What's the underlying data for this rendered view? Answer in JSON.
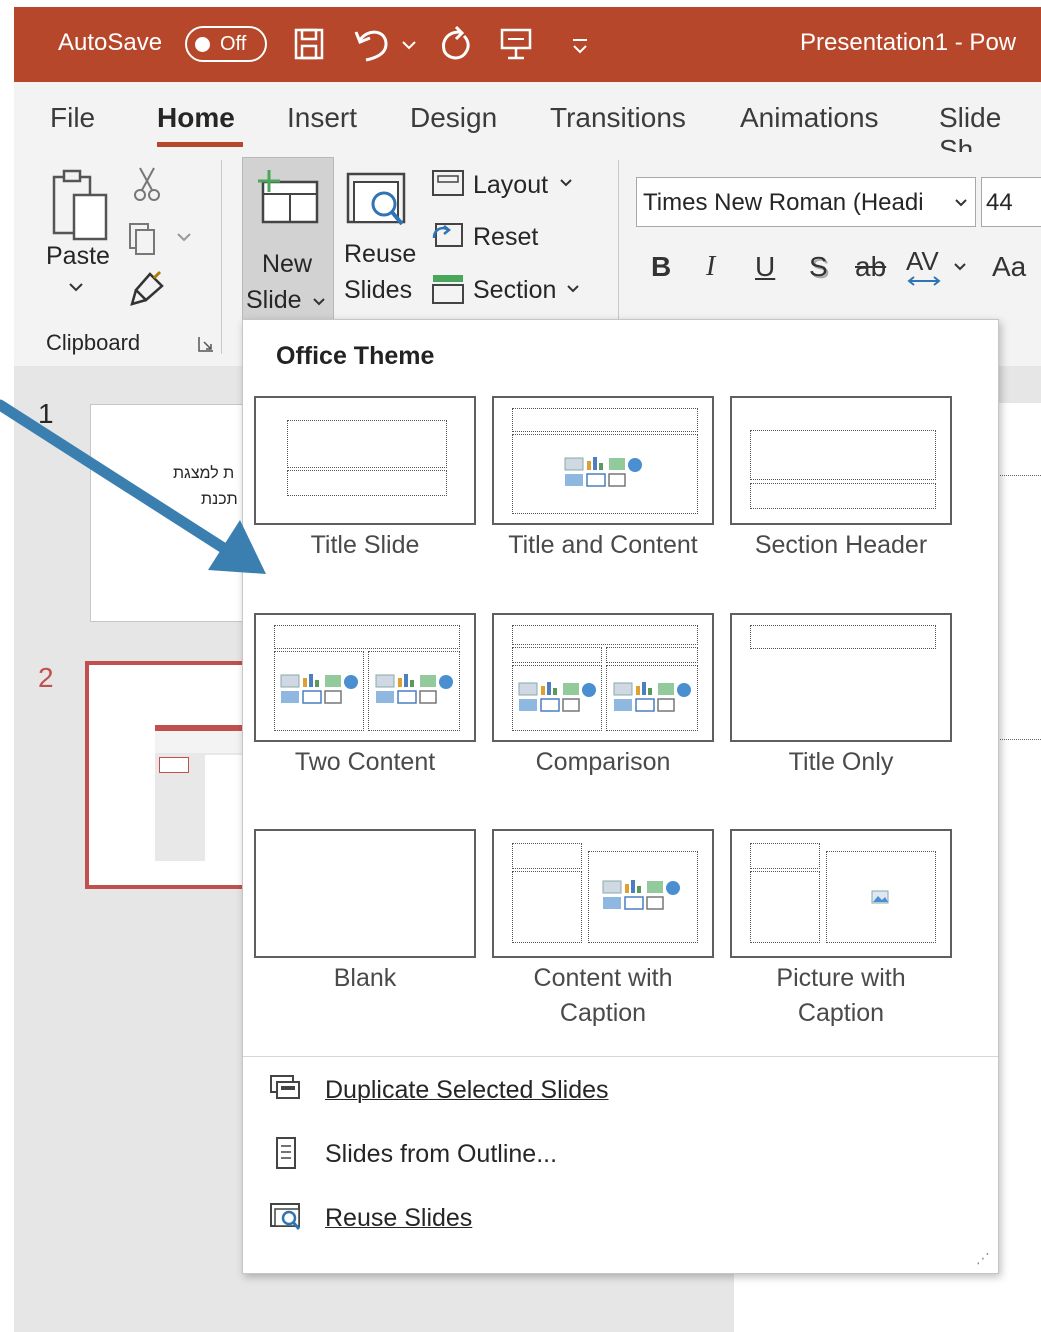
{
  "titlebar": {
    "autosave_label": "AutoSave",
    "autosave_state": "Off",
    "document_title": "Presentation1 - Pow",
    "color": "#b7472a"
  },
  "tabs": [
    {
      "label": "File"
    },
    {
      "label": "Home"
    },
    {
      "label": "Insert"
    },
    {
      "label": "Design"
    },
    {
      "label": "Transitions"
    },
    {
      "label": "Animations"
    },
    {
      "label": "Slide Sh"
    }
  ],
  "ribbon": {
    "paste_label": "Paste",
    "clipboard_label": "Clipboard",
    "new_slide_label_1": "New",
    "new_slide_label_2": "Slide",
    "reuse_label_1": "Reuse",
    "reuse_label_2": "Slides",
    "layout_label": "Layout",
    "reset_label": "Reset",
    "section_label": "Section",
    "font_name": "Times New Roman (Headi",
    "font_size": "44",
    "bold": "B",
    "italic": "I",
    "underline": "U",
    "shadow": "S",
    "strike": "ab",
    "spacing": "AV",
    "case": "Aa"
  },
  "slides": {
    "slide1_number": "1",
    "slide1_text_1": "ת למצגת",
    "slide1_text_2": "תכנת",
    "slide2_number": "2"
  },
  "dropdown": {
    "title": "Office Theme",
    "layouts": [
      {
        "label": "Title Slide"
      },
      {
        "label": "Title and Content"
      },
      {
        "label": "Section Header"
      },
      {
        "label": "Two Content"
      },
      {
        "label": "Comparison"
      },
      {
        "label": "Title Only"
      },
      {
        "label": "Blank"
      },
      {
        "label_1": "Content with",
        "label_2": "Caption"
      },
      {
        "label_1": "Picture with",
        "label_2": "Caption"
      }
    ],
    "menu": [
      {
        "label": "Duplicate Selected Slides"
      },
      {
        "label": "Slides from Outline..."
      },
      {
        "label": "Reuse Slides"
      }
    ]
  },
  "annotation_arrow_color": "#3b7fb1"
}
